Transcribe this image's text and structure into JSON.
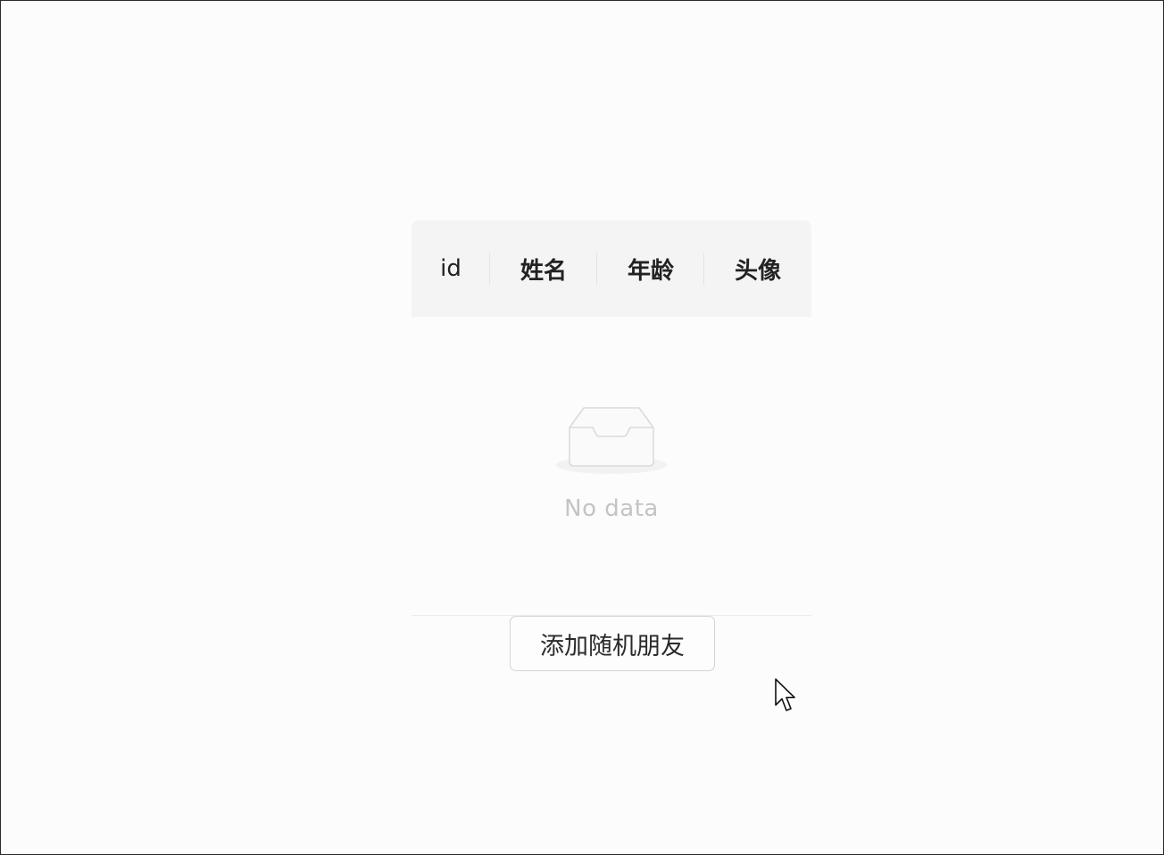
{
  "table": {
    "columns": [
      {
        "label": "id"
      },
      {
        "label": "姓名"
      },
      {
        "label": "年龄"
      },
      {
        "label": "头像"
      }
    ],
    "rows": [],
    "empty_text": "No data",
    "empty_icon": "inbox-icon"
  },
  "actions": {
    "add_friend_label": "添加随机朋友"
  },
  "cursor": {
    "icon": "mouse-pointer-icon"
  },
  "colors": {
    "background": "#fcfcfc",
    "header_bg": "#f4f4f4",
    "empty_text": "#c4c4c4",
    "button_border": "#d4d4d4"
  }
}
